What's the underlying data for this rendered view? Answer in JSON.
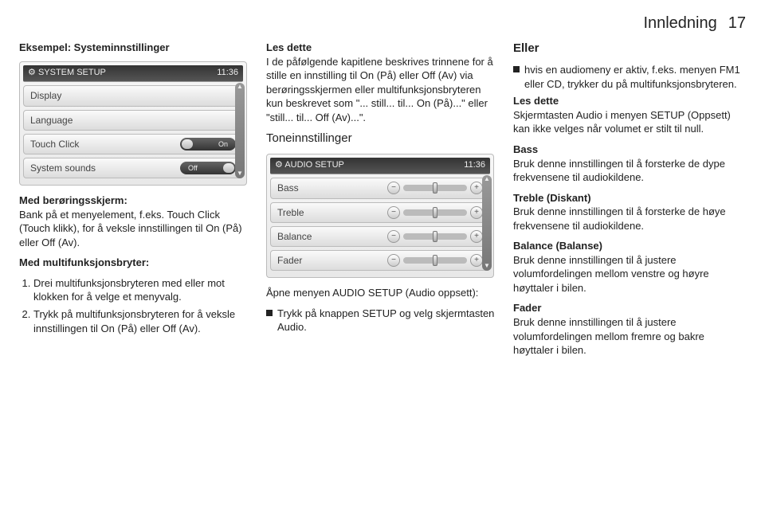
{
  "header": {
    "title": "Innledning",
    "page": "17"
  },
  "col1": {
    "heading": "Eksempel: Systeminnstillinger",
    "shot": {
      "title": "SYSTEM SETUP",
      "time": "11:36",
      "rows": [
        {
          "label": "Display"
        },
        {
          "label": "Language"
        },
        {
          "label": "Touch Click",
          "toggle": "On"
        },
        {
          "label": "System sounds",
          "toggle": "Off"
        }
      ]
    },
    "p1_label": "Med berøringsskjerm:",
    "p1_text": "Bank på et menyelement, f.eks. Touch Click (Touch klikk), for å veksle innstillingen til On (På) eller Off (Av).",
    "p2_label": "Med multifunksjonsbryter:",
    "step1": "Drei multifunksjonsbryteren med eller mot klokken for å velge et menyvalg.",
    "step2": "Trykk på multifunksjonsbryteren for å veksle innstillingen til On (På) eller Off (Av)."
  },
  "col2": {
    "les_label": "Les dette",
    "les_text": "I de påfølgende kapitlene beskrives trinnene for å stille en innstilling til On (På) eller Off (Av) via berørings­skjermen eller multifunksjonsbryte­ren kun beskrevet som \"... still... til... On (På)...\" eller \"still... til... Off (Av)...\".",
    "tone_heading": "Toneinnstillinger",
    "shot": {
      "title": "AUDIO SETUP",
      "time": "11:36",
      "rows": [
        {
          "label": "Bass"
        },
        {
          "label": "Treble"
        },
        {
          "label": "Balance"
        },
        {
          "label": "Fader"
        }
      ]
    },
    "open_label": "Åpne menyen AUDIO SETUP (Audio oppsett):",
    "open_text": "Trykk på knappen SETUP og velg skjermtasten Audio."
  },
  "col3": {
    "eller_label": "Eller",
    "eller_text": "hvis en audiomeny er aktiv, f.eks. menyen FM1 eller CD, trykker du på multifunksjonsbryteren.",
    "les_label": "Les dette",
    "les_text": "Skjermtasten Audio i menyen SETUP (Oppsett) kan ikke velges når volumet er stilt til null.",
    "bass_label": "Bass",
    "bass_text": "Bruk denne innstillingen til å forsterke de dype frekvensene til audiokildene.",
    "treble_label": "Treble (Diskant)",
    "treble_text": "Bruk denne innstillingen til å forsterke de høye frekvensene til audiokildene.",
    "balance_label": "Balance (Balanse)",
    "balance_text": "Bruk denne innstillingen til å justere volumfordelingen mellom venstre og høyre høyttaler i bilen.",
    "fader_label": "Fader",
    "fader_text": "Bruk denne innstillingen til å justere volumfordelingen mellom fremre og bakre høyttaler i bilen."
  },
  "icons": {
    "gear": "⚙"
  }
}
